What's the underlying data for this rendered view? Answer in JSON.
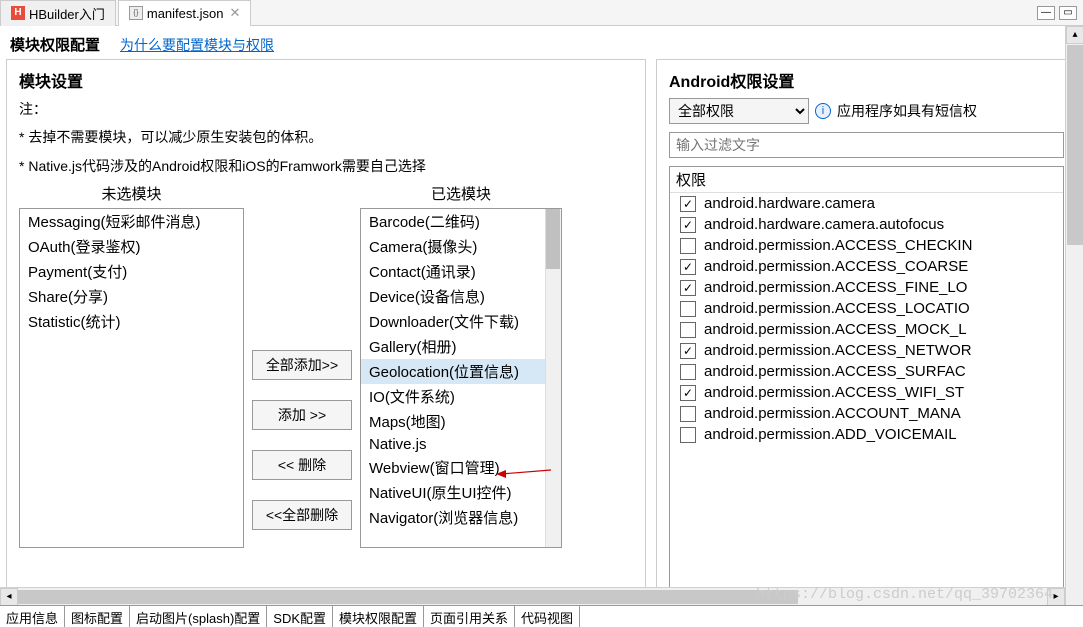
{
  "tabs": {
    "tab1": "HBuilder入门",
    "tab2": "manifest.json"
  },
  "header": {
    "title": "模块权限配置",
    "link": "为什么要配置模块与权限"
  },
  "modulePanel": {
    "title": "模块设置",
    "noteLabel": "注：",
    "note1": "* 去掉不需要模块，可以减少原生安装包的体积。",
    "note2": "* Native.js代码涉及的Android权限和iOS的Framwork需要自己选择",
    "unselectedHeader": "未选模块",
    "selectedHeader": "已选模块",
    "unselected": [
      "Messaging(短彩邮件消息)",
      "OAuth(登录鉴权)",
      "Payment(支付)",
      "Share(分享)",
      "Statistic(统计)"
    ],
    "selected": [
      "Barcode(二维码)",
      "Camera(摄像头)",
      "Contact(通讯录)",
      "Device(设备信息)",
      "Downloader(文件下载)",
      "Gallery(相册)",
      "Geolocation(位置信息)",
      "IO(文件系统)",
      "Maps(地图)",
      "Native.js",
      "Webview(窗口管理)",
      "NativeUI(原生UI控件)",
      "Navigator(浏览器信息)"
    ],
    "buttons": {
      "addAll": "全部添加>>",
      "add": "添加  >>",
      "remove": "<<  删除",
      "removeAll": "<<全部删除"
    }
  },
  "permPanel": {
    "title": "Android权限设置",
    "selectValue": "全部权限",
    "hint": "应用程序如具有短信权",
    "inputPlaceholder": "输入过滤文字",
    "listHeader": "权限",
    "items": [
      {
        "label": "android.hardware.camera",
        "checked": true
      },
      {
        "label": "android.hardware.camera.autofocus",
        "checked": true
      },
      {
        "label": "android.permission.ACCESS_CHECKIN",
        "checked": false
      },
      {
        "label": "android.permission.ACCESS_COARSE",
        "checked": true
      },
      {
        "label": "android.permission.ACCESS_FINE_LO",
        "checked": true
      },
      {
        "label": "android.permission.ACCESS_LOCATIO",
        "checked": false
      },
      {
        "label": "android.permission.ACCESS_MOCK_L",
        "checked": false
      },
      {
        "label": "android.permission.ACCESS_NETWOR",
        "checked": true
      },
      {
        "label": "android.permission.ACCESS_SURFAC",
        "checked": false
      },
      {
        "label": "android.permission.ACCESS_WIFI_ST",
        "checked": true
      },
      {
        "label": "android.permission.ACCOUNT_MANA",
        "checked": false
      },
      {
        "label": "android.permission.ADD_VOICEMAIL",
        "checked": false
      }
    ]
  },
  "bottomTabs": [
    "应用信息",
    "图标配置",
    "启动图片(splash)配置",
    "SDK配置",
    "模块权限配置",
    "页面引用关系",
    "代码视图"
  ],
  "watermark": "https://blog.csdn.net/qq_39702364"
}
